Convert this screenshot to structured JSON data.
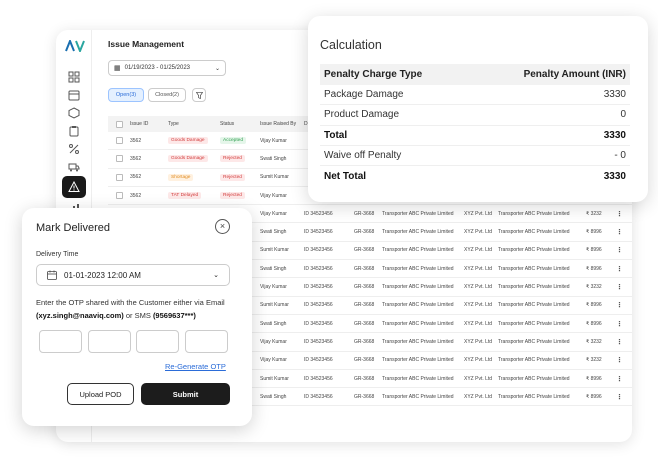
{
  "app": {
    "title": "Issue Management",
    "date_range": "01/19/2023 - 01/25/2023",
    "tabs": [
      {
        "label": "Open(3)"
      },
      {
        "label": "Closed(2)"
      }
    ],
    "table": {
      "headers": [
        "Issue ID",
        "Type",
        "Status",
        "Issue Raised By",
        "D"
      ],
      "top_rows": [
        {
          "id": "3562",
          "type": "Goods Damage",
          "type_color": "red",
          "status": "Accepted",
          "status_color": "green",
          "raised_by": "Vijay Kumar"
        },
        {
          "id": "3562",
          "type": "Goods Damage",
          "type_color": "red",
          "status": "Rejected",
          "status_color": "red",
          "raised_by": "Swati Singh"
        },
        {
          "id": "3562",
          "type": "Shortage",
          "type_color": "orange",
          "status": "Rejected",
          "status_color": "red",
          "raised_by": "Sumit Kumar"
        },
        {
          "id": "3562",
          "type": "TAT Delayed",
          "type_color": "red",
          "status": "Rejected",
          "status_color": "red",
          "raised_by": "Vijay Kumar"
        }
      ],
      "bottom_rows": [
        {
          "raised_by": "Vijay Kumar",
          "doc": "ID 34523456",
          "gr": "GR-3668",
          "transporter": "Transporter ABC Private Limited",
          "consignee": "XYZ Pvt. Ltd",
          "transporter2": "Transporter ABC Private Limited",
          "amount": "₹ 3232"
        },
        {
          "raised_by": "Swati Singh",
          "doc": "ID 34523456",
          "gr": "GR-3668",
          "transporter": "Transporter ABC Private Limited",
          "consignee": "XYZ Pvt. Ltd",
          "transporter2": "Transporter ABC Private Limited",
          "amount": "₹ 8996"
        },
        {
          "raised_by": "Sumit Kumar",
          "doc": "ID 34523456",
          "gr": "GR-3668",
          "transporter": "Transporter ABC Private Limited",
          "consignee": "XYZ Pvt. Ltd",
          "transporter2": "Transporter ABC Private Limited",
          "amount": "₹ 8996"
        },
        {
          "raised_by": "Swati Singh",
          "doc": "ID 34523456",
          "gr": "GR-3668",
          "transporter": "Transporter ABC Private Limited",
          "consignee": "XYZ Pvt. Ltd",
          "transporter2": "Transporter ABC Private Limited",
          "amount": "₹ 8996"
        },
        {
          "raised_by": "Vijay Kumar",
          "doc": "ID 34523456",
          "gr": "GR-3668",
          "transporter": "Transporter ABC Private Limited",
          "consignee": "XYZ Pvt. Ltd",
          "transporter2": "Transporter ABC Private Limited",
          "amount": "₹ 3232"
        },
        {
          "raised_by": "Sumit Kumar",
          "doc": "ID 34523456",
          "gr": "GR-3668",
          "transporter": "Transporter ABC Private Limited",
          "consignee": "XYZ Pvt. Ltd",
          "transporter2": "Transporter ABC Private Limited",
          "amount": "₹ 8996"
        },
        {
          "raised_by": "Swati Singh",
          "doc": "ID 34523456",
          "gr": "GR-3668",
          "transporter": "Transporter ABC Private Limited",
          "consignee": "XYZ Pvt. Ltd",
          "transporter2": "Transporter ABC Private Limited",
          "amount": "₹ 8996"
        },
        {
          "raised_by": "Vijay Kumar",
          "doc": "ID 34523456",
          "gr": "GR-3668",
          "transporter": "Transporter ABC Private Limited",
          "consignee": "XYZ Pvt. Ltd",
          "transporter2": "Transporter ABC Private Limited",
          "amount": "₹ 3232"
        },
        {
          "raised_by": "Vijay Kumar",
          "doc": "ID 34523456",
          "gr": "GR-3668",
          "transporter": "Transporter ABC Private Limited",
          "consignee": "XYZ Pvt. Ltd",
          "transporter2": "Transporter ABC Private Limited",
          "amount": "₹ 3232"
        },
        {
          "raised_by": "Sumit Kumar",
          "doc": "ID 34523456",
          "gr": "GR-3668",
          "transporter": "Transporter ABC Private Limited",
          "consignee": "XYZ Pvt. Ltd",
          "transporter2": "Transporter ABC Private Limited",
          "amount": "₹ 8996"
        },
        {
          "raised_by": "Swati Singh",
          "doc": "ID 34523456",
          "gr": "GR-3668",
          "transporter": "Transporter ABC Private Limited",
          "consignee": "XYZ Pvt. Ltd",
          "transporter2": "Transporter ABC Private Limited",
          "amount": "₹ 8996"
        }
      ]
    },
    "sidebar_icons": [
      "grid-icon",
      "calendar-icon",
      "box-icon",
      "clipboard-icon",
      "percent-icon",
      "truck-icon",
      "warning-icon",
      "chart-icon"
    ],
    "colors": {
      "badge_red": "#d23c3c",
      "badge_green": "#2f9e4f",
      "badge_orange": "#e08a1e",
      "brand": "#1a1a1a",
      "link": "#2b6cd8"
    }
  },
  "calculation": {
    "title": "Calculation",
    "header": {
      "label": "Penalty Charge Type",
      "value": "Penalty Amount (INR)"
    },
    "rows": [
      {
        "label": "Package Damage",
        "value": "3330",
        "bold": false
      },
      {
        "label": "Product Damage",
        "value": "0",
        "bold": false
      },
      {
        "label": "Total",
        "value": "3330",
        "bold": true
      },
      {
        "label": "Waive off Penalty",
        "value": "- 0",
        "bold": false
      },
      {
        "label": "Net Total",
        "value": "3330",
        "bold": true
      }
    ]
  },
  "mark_delivered": {
    "title": "Mark Delivered",
    "close_glyph": "×",
    "delivery_time_label": "Delivery Time",
    "delivery_time_value": "01-01-2023 12:00 AM",
    "otp_text_1": "Enter the OTP shared with the Customer either via Email ",
    "otp_email": "(xyz.singh@naaviq.com)",
    "otp_text_2": " or SMS ",
    "otp_phone": "(9569637***)",
    "regenerate_label": "Re-Generate OTP",
    "upload_label": "Upload POD",
    "submit_label": "Submit"
  }
}
